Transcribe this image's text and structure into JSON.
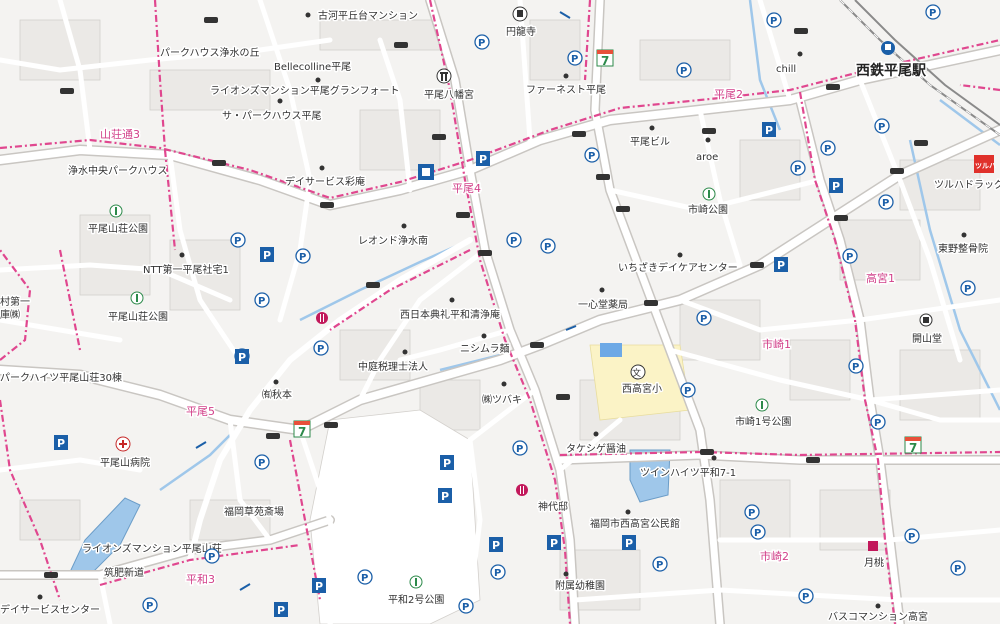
{
  "map": {
    "station": {
      "name": "西鉄平尾駅"
    },
    "areas": [
      "山荘通3",
      "平尾4",
      "平尾2",
      "平尾5",
      "平和3",
      "高宮1",
      "市崎1",
      "市崎2"
    ],
    "places": [
      "古河平丘台マンション",
      "円龍寺",
      "パークハウス浄水の丘",
      "Bellecolline平尾",
      "ライオンズマンション平尾グランフォート",
      "平尾八幡宮",
      "ファーネスト平尾",
      "サ・パークハウス平尾",
      "平尾ビル",
      "chill",
      "aroe",
      "浄水中央パークハウス",
      "デイサービス彩庵",
      "市崎公園",
      "平尾山荘公園",
      "レオンド浄水南",
      "いちざきデイケアセンター",
      "東野整骨院",
      "NTT第一平尾社宅1",
      "平尾山荘公園",
      "一心堂薬局",
      "開山堂",
      "西日本典礼平和清浄庵",
      "ニシムラ麺",
      "西高宮小",
      "中庭税理士法人",
      "㈲秋本",
      "㈱ツバキ",
      "市崎1号公園",
      "平尾山病院",
      "タケシゲ醤油",
      "ツインハイツ平和7-1",
      "福岡草苑斎場",
      "神代邸",
      "福岡市西高宮公民館",
      "ライオンズマンション平尾山荘",
      "筑肥新道",
      "月桃",
      "附属幼稚園",
      "平和2号公園",
      "デイサービスセンター",
      "バスコマンション高宮",
      "ツルハドラッグ",
      "パークハイツ平尾山荘30棟",
      "村第一",
      "庫㈱"
    ],
    "icons": {
      "parking": "P",
      "convenience_store": "7",
      "station": "train-icon",
      "park": "park-icon",
      "shrine": "shrine-icon",
      "temple": "temple-icon",
      "school": "文",
      "hospital": "hospital-icon",
      "police_box": "police-icon",
      "restaurant": "restaurant-icon",
      "drugstore_brand": "ツルハ"
    },
    "colors": {
      "background": "#f4f3f1",
      "road": "#ffffff",
      "boundary": "#e0478f",
      "parking": "#1b5fa8",
      "water": "#9fc7ea",
      "school": "#fbf3c6",
      "label": "#333333"
    }
  }
}
